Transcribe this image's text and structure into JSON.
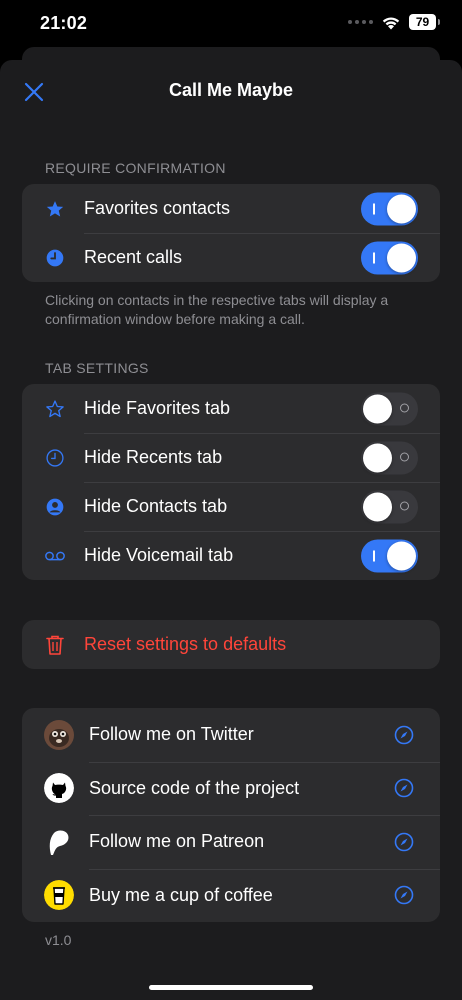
{
  "status_bar": {
    "time": "21:02",
    "battery": "79"
  },
  "header": {
    "title": "Call Me Maybe"
  },
  "require_confirmation": {
    "title": "REQUIRE CONFIRMATION",
    "items": [
      {
        "label": "Favorites contacts",
        "icon": "star-filled-icon",
        "enabled": true
      },
      {
        "label": "Recent calls",
        "icon": "clock-filled-icon",
        "enabled": true
      }
    ],
    "footnote": "Clicking on contacts in the respective tabs will display a confirmation window before making a call."
  },
  "tab_settings": {
    "title": "TAB SETTINGS",
    "items": [
      {
        "label": "Hide Favorites tab",
        "icon": "star-outline-icon",
        "enabled": false
      },
      {
        "label": "Hide Recents tab",
        "icon": "clock-outline-icon",
        "enabled": false
      },
      {
        "label": "Hide Contacts tab",
        "icon": "person-circle-icon",
        "enabled": false
      },
      {
        "label": "Hide Voicemail tab",
        "icon": "voicemail-icon",
        "enabled": true
      }
    ]
  },
  "reset": {
    "label": "Reset settings to defaults",
    "icon": "trash-icon"
  },
  "links": [
    {
      "label": "Follow me on Twitter",
      "icon": "twitter-avatar-icon"
    },
    {
      "label": "Source code of the project",
      "icon": "github-icon"
    },
    {
      "label": "Follow me on Patreon",
      "icon": "patreon-icon"
    },
    {
      "label": "Buy me a cup of coffee",
      "icon": "coffee-icon"
    }
  ],
  "version": "v1.0",
  "colors": {
    "accent": "#3478f6",
    "destructive": "#ff453a",
    "sheet": "#1c1c1e",
    "group": "#2c2c2e",
    "secondary_text": "#8e8e93"
  }
}
